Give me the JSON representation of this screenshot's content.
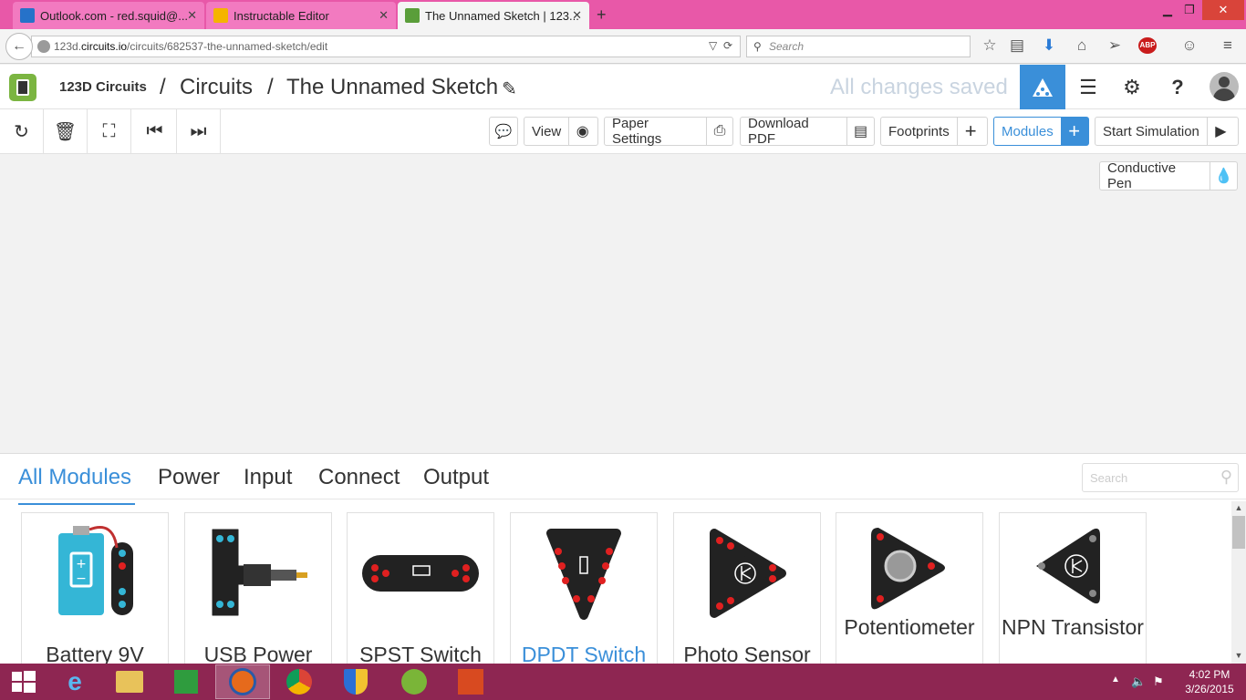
{
  "browser": {
    "tabs": [
      {
        "label": "Outlook.com - red.squid@...",
        "icon_color": "#2672c9"
      },
      {
        "label": "Instructable Editor",
        "icon_color": "#f5b400"
      },
      {
        "label": "The Unnamed Sketch | 123...",
        "icon_color": "#5a9e3a"
      }
    ],
    "url_prefix": "123d.",
    "url_domain": "circuits.io",
    "url_path": "/circuits/682537-the-unnamed-sketch/edit",
    "search_placeholder": "Search",
    "abp_label": "ABP"
  },
  "app": {
    "brand": "123D Circuits",
    "breadcrumb": [
      "Circuits",
      "The Unnamed Sketch"
    ],
    "separator": "/",
    "status": "All changes saved",
    "accent": "#3a8fd9"
  },
  "toolbar": {
    "view": "View",
    "paper_settings": "Paper Settings",
    "download_pdf": "Download PDF",
    "footprints": "Footprints",
    "modules": "Modules",
    "start_simulation": "Start Simulation",
    "conductive_pen": "Conductive Pen"
  },
  "panel": {
    "tabs": [
      "All Modules",
      "Power",
      "Input",
      "Connect",
      "Output"
    ],
    "search_placeholder": "Search",
    "modules": [
      {
        "name": "Battery 9V"
      },
      {
        "name": "USB Power"
      },
      {
        "name": "SPST Switch"
      },
      {
        "name": "DPDT Switch"
      },
      {
        "name": "Photo Sensor"
      },
      {
        "name": "Potentiometer"
      },
      {
        "name": "NPN Transistor"
      }
    ]
  },
  "taskbar": {
    "time": "4:02 PM",
    "date": "3/26/2015"
  }
}
